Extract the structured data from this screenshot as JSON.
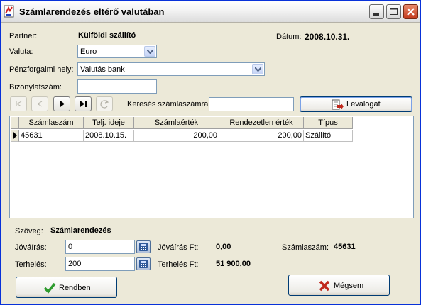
{
  "window": {
    "title": "Számlarendezés eltérő valutában",
    "icon": "app-icon",
    "controls": [
      "minimize-icon",
      "maximize-icon",
      "close-icon"
    ]
  },
  "header": {
    "partner_label": "Partner:",
    "partner_value": "Külföldi szállító",
    "date_label": "Dátum:",
    "date_value": "2008.10.31.",
    "currency_label": "Valuta:",
    "currency_value": "Euro",
    "cashplace_label": "Pénzforgalmi hely:",
    "cashplace_value": "Valutás bank",
    "voucher_label": "Bizonylatszám:",
    "voucher_value": ""
  },
  "navigator": {
    "search_label": "Keresés számlaszámra:",
    "search_value": "",
    "filter_button": "Leválogat",
    "buttons": [
      "first-icon",
      "prior-icon",
      "next-icon",
      "last-icon",
      "refresh-icon"
    ]
  },
  "grid": {
    "columns": [
      "Számlaszám",
      "Telj. ideje",
      "Számlaérték",
      "Rendezetlen érték",
      "Típus"
    ],
    "rows": [
      [
        "45631",
        "2008.10.15.",
        "200,00",
        "200,00",
        "Szállító"
      ]
    ]
  },
  "footer": {
    "text_label": "Szöveg:",
    "text_value": "Számlarendezés",
    "credit_label": "Jóváírás:",
    "credit_value": "0",
    "credit_ft_label": "Jóváírás Ft:",
    "credit_ft_value": "0,00",
    "invoice_label": "Számlaszám:",
    "invoice_value": "45631",
    "debit_label": "Terhelés:",
    "debit_value": "200",
    "debit_ft_label": "Terhelés Ft:",
    "debit_ft_value": "51 900,00",
    "ok_button": "Rendben",
    "cancel_button": "Mégsem"
  },
  "colors": {
    "title_border": "#0831d9",
    "ok_check": "#2e9b2e",
    "cancel_x": "#c0281c",
    "filter_arrow": "#c0281c"
  }
}
